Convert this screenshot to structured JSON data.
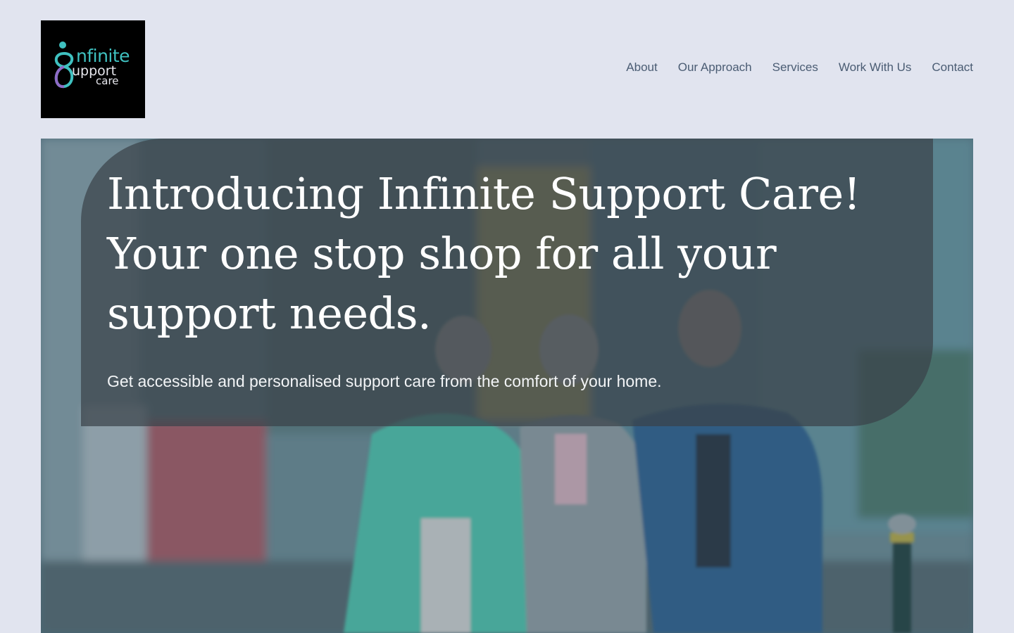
{
  "brand": {
    "logo_line1": "nfinite",
    "logo_line2": "upport",
    "logo_line3": "care",
    "colors": {
      "teal": "#3fc1c0",
      "purple": "#8e6bc6",
      "background": "#000000"
    }
  },
  "nav": {
    "items": [
      {
        "label": "About"
      },
      {
        "label": "Our Approach"
      },
      {
        "label": "Services"
      },
      {
        "label": "Work With Us"
      },
      {
        "label": "Contact"
      }
    ]
  },
  "hero": {
    "title": "Introducing Infinite Support Care! Your one stop shop for all your support needs.",
    "subtitle": "Get accessible and personalised support care from the comfort of your home."
  },
  "colors": {
    "page_background": "#e1e4ef",
    "nav_text": "#4a5c73",
    "hero_panel": "#3a434a"
  }
}
